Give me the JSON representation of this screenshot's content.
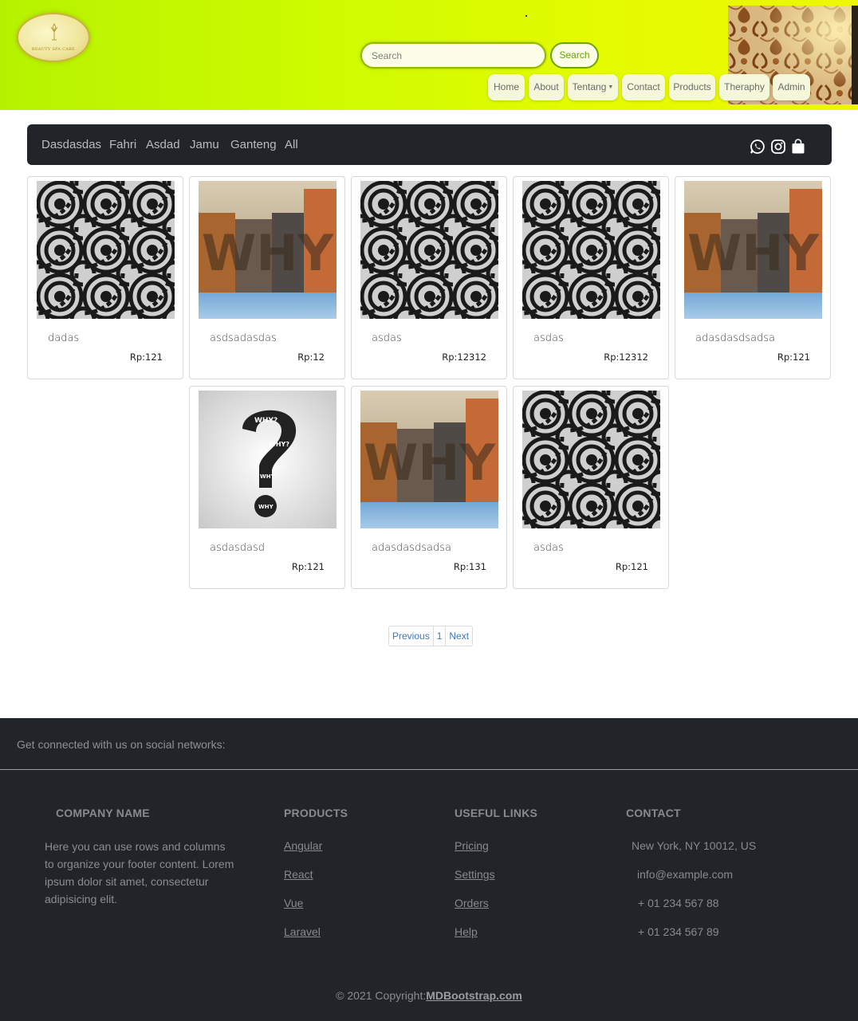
{
  "header": {
    "logo_text": "BEAUTY SPA CARE",
    "search_placeholder": "Search",
    "search_button": "Search",
    "nav": [
      {
        "label": "Home"
      },
      {
        "label": "About"
      },
      {
        "label": "Tentang",
        "dropdown": true
      },
      {
        "label": "Contact"
      },
      {
        "label": "Products"
      },
      {
        "label": "Theraphy"
      },
      {
        "label": "Admin"
      }
    ]
  },
  "categories": [
    "Dasdasdas",
    "Fahri",
    "Asdad",
    "Jamu",
    "Ganteng",
    "All"
  ],
  "social_icons": [
    "whatsapp-icon",
    "instagram-icon",
    "shopping-bag-icon"
  ],
  "products": [
    {
      "name": "dadas",
      "price": "Rp:121",
      "image": "stripes"
    },
    {
      "name": "asdsadasdas",
      "price": "Rp:12",
      "image": "why-blocks"
    },
    {
      "name": "asdas",
      "price": "Rp:12312",
      "image": "stripes"
    },
    {
      "name": "asdas",
      "price": "Rp:12312",
      "image": "stripes"
    },
    {
      "name": "adasdasdsadsa",
      "price": "Rp:121",
      "image": "why-blocks"
    },
    {
      "name": "asdasdasd",
      "price": "Rp:121",
      "image": "question-mark"
    },
    {
      "name": "adasdasdsadsa",
      "price": "Rp:131",
      "image": "why-blocks"
    },
    {
      "name": "asdas",
      "price": "Rp:121",
      "image": "stripes"
    }
  ],
  "pagination": {
    "previous": "Previous",
    "page": "1",
    "next": "Next"
  },
  "footer": {
    "connect_text": "Get connected with us on social networks:",
    "company": {
      "heading": "COMPANY NAME",
      "description": "Here you can use rows and columns to organize your footer content. Lorem ipsum dolor sit amet, consectetur adipisicing elit."
    },
    "products": {
      "heading": "PRODUCTS",
      "links": [
        "Angular",
        "React",
        "Vue",
        "Laravel"
      ]
    },
    "useful_links": {
      "heading": "USEFUL LINKS",
      "links": [
        "Pricing",
        "Settings",
        "Orders",
        "Help"
      ]
    },
    "contact": {
      "heading": "CONTACT",
      "lines": [
        "New York, NY 10012, US",
        "info@example.com",
        "+ 01 234 567 88",
        "+ 01 234 567 89"
      ]
    },
    "copyright_prefix": "© 2021 Copyright:",
    "copyright_link": "MDBootstrap.com"
  },
  "colors": {
    "header_start": "#b6f200",
    "header_end": "#ecf700",
    "dark": "#212529",
    "link_blue": "#3a78c2"
  }
}
